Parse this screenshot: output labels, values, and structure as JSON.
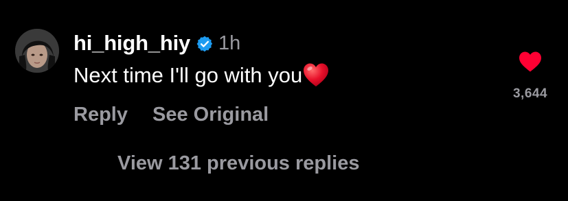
{
  "comment": {
    "avatar": "profile-photo",
    "username": "hi_high_hiy",
    "verified": true,
    "verified_color": "#1d9bf0",
    "time": "1h",
    "text": "Next time I'll go with you",
    "text_emoji": "red-heart-emoji",
    "like_icon": "heart-icon",
    "like_color": "#ff0033",
    "liked": true,
    "like_count": "3,644",
    "actions": {
      "reply_label": "Reply",
      "see_original_label": "See Original"
    },
    "view_replies_label": "View 131 previous replies"
  },
  "colors": {
    "background": "#000000",
    "primary_text": "#ffffff",
    "secondary_text": "#9a9aa0"
  }
}
